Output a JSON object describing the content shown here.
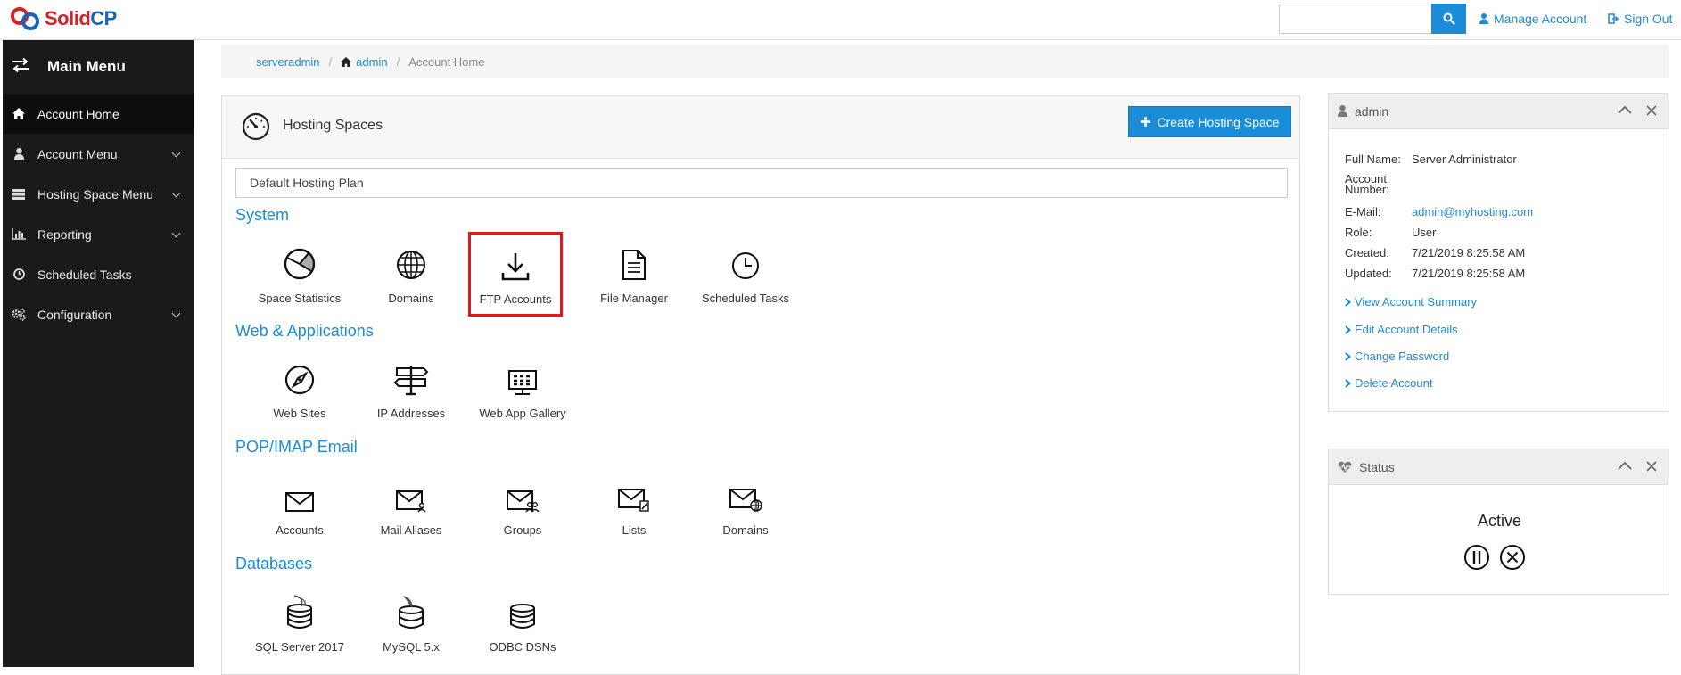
{
  "brand": {
    "name_left": "Solid",
    "name_right": "CP"
  },
  "topbar": {
    "search_value": "",
    "manage_account": "Manage Account",
    "sign_out": "Sign Out"
  },
  "sidebar": {
    "title": "Main Menu",
    "items": [
      {
        "label": "Account Home"
      },
      {
        "label": "Account Menu"
      },
      {
        "label": "Hosting Space Menu"
      },
      {
        "label": "Reporting"
      },
      {
        "label": "Scheduled Tasks"
      },
      {
        "label": "Configuration"
      }
    ]
  },
  "breadcrumb": {
    "items": [
      "serveradmin",
      "admin",
      "Account Home"
    ]
  },
  "main": {
    "title": "Hosting Spaces",
    "create_button": "Create Hosting Space",
    "plan": "Default Hosting Plan",
    "sections": [
      {
        "title": "System",
        "tiles": [
          "Space Statistics",
          "Domains",
          "FTP Accounts",
          "File Manager",
          "Scheduled Tasks"
        ]
      },
      {
        "title": "Web & Applications",
        "tiles": [
          "Web Sites",
          "IP Addresses",
          "Web App Gallery"
        ]
      },
      {
        "title": "POP/IMAP Email",
        "tiles": [
          "Accounts",
          "Mail Aliases",
          "Groups",
          "Lists",
          "Domains"
        ]
      },
      {
        "title": "Databases",
        "tiles": [
          "SQL Server 2017",
          "MySQL 5.x",
          "ODBC DSNs"
        ]
      }
    ]
  },
  "account_panel": {
    "title": "admin",
    "fields": [
      {
        "key": "Full Name:",
        "value": "Server Administrator"
      },
      {
        "key": "Account Number:",
        "value": ""
      },
      {
        "key": "E-Mail:",
        "value": "admin@myhosting.com"
      },
      {
        "key": "Role:",
        "value": "User"
      },
      {
        "key": "Created:",
        "value": "7/21/2019 8:25:58 AM"
      },
      {
        "key": "Updated:",
        "value": "7/21/2019 8:25:58 AM"
      }
    ],
    "links": [
      "View Account Summary",
      "Edit Account Details",
      "Change Password",
      "Delete Account"
    ]
  },
  "status_panel": {
    "title": "Status",
    "status": "Active"
  },
  "colors": {
    "accent": "#1a8cd8",
    "sidebar": "#1a1a1a",
    "highlight": "#e0181f",
    "brand_red": "#d2232a",
    "brand_blue": "#1a63b8"
  }
}
